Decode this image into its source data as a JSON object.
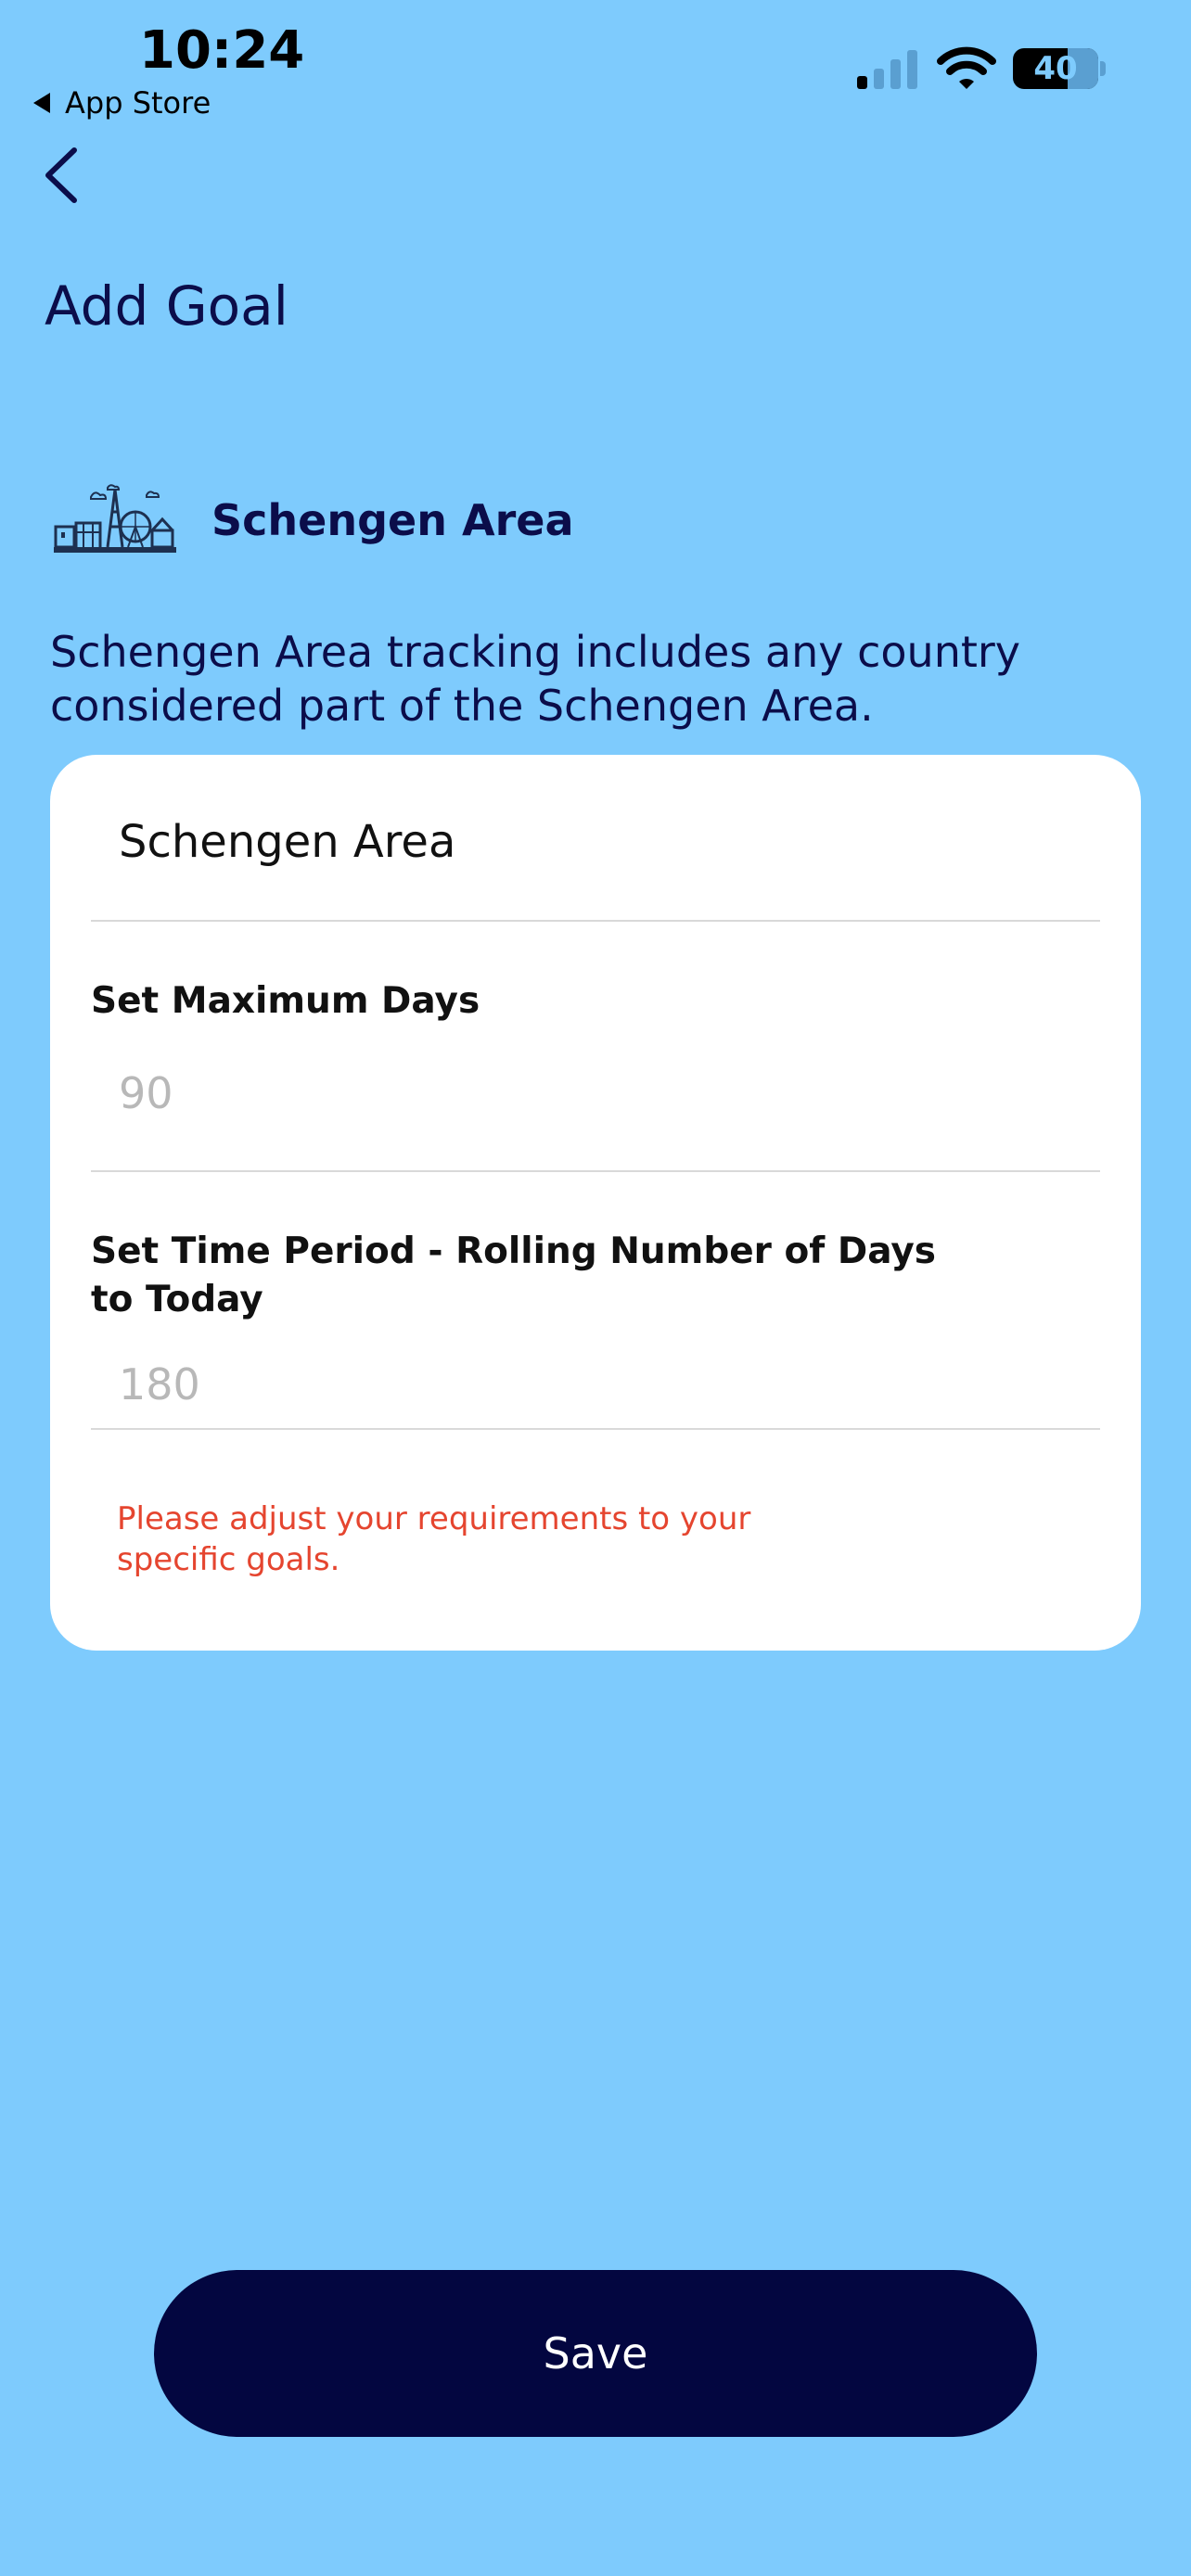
{
  "status_bar": {
    "time": "10:24",
    "back_to_app": "App Store",
    "battery_percent": "40"
  },
  "header": {
    "title": "Add Goal"
  },
  "goal": {
    "name": "Schengen Area",
    "icon": "europe-landmarks-icon",
    "description": "Schengen Area tracking includes any country considered part of the Schengen Area."
  },
  "form": {
    "area_value": "Schengen Area",
    "max_days_label": "Set Maximum Days",
    "max_days_placeholder": "90",
    "time_period_label": "Set Time Period - Rolling Number of Days to Today",
    "time_period_placeholder": "180",
    "hint": "Please adjust your requirements to your specific goals."
  },
  "actions": {
    "save_label": "Save"
  },
  "colors": {
    "background": "#7ecbfd",
    "primary": "#030640",
    "warning": "#e5452f"
  }
}
